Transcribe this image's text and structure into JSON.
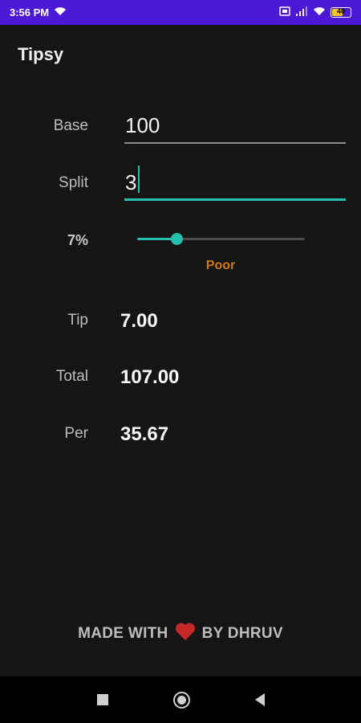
{
  "status_bar": {
    "time": "3:56 PM",
    "battery": "40"
  },
  "app": {
    "title": "Tipsy"
  },
  "form": {
    "base_label": "Base",
    "base_value": "100",
    "split_label": "Split",
    "split_value": "3"
  },
  "tip_slider": {
    "percent_label": "7%",
    "value_percent": 7,
    "range": [
      0,
      30
    ],
    "description": "Poor",
    "accent_color": "#25bfae",
    "description_color": "#d07a1a"
  },
  "results": {
    "tip_label": "Tip",
    "tip_value": "7.00",
    "total_label": "Total",
    "total_value": "107.00",
    "per_label": "Per",
    "per_value": "35.67"
  },
  "footer": {
    "prefix": "MADE WITH",
    "suffix": "BY DHRUV",
    "icon": "heart-icon"
  },
  "colors": {
    "status_bar": "#4b18d6",
    "background": "#151515",
    "heart": "#c62828"
  }
}
